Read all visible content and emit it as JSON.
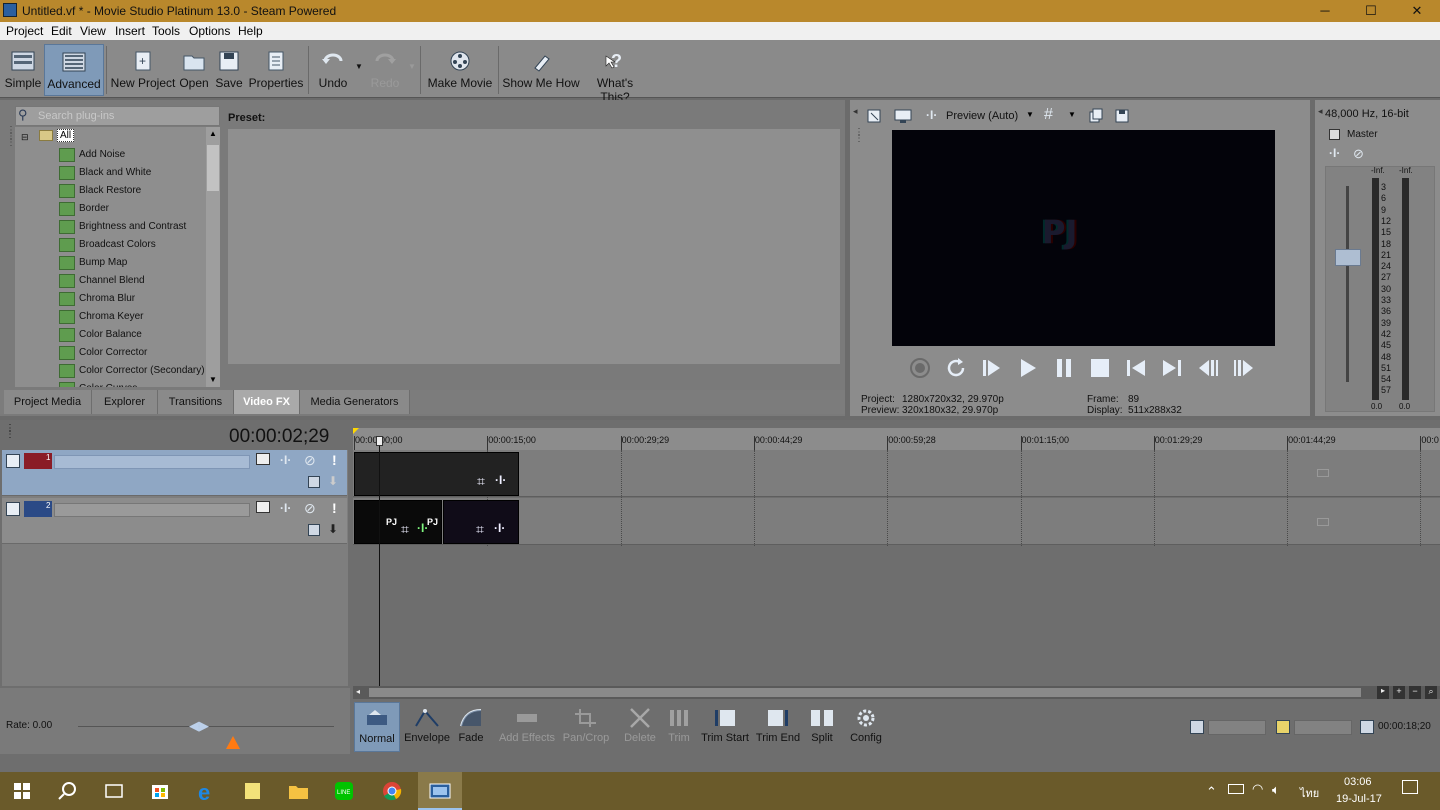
{
  "window": {
    "title": "Untitled.vf * - Movie Studio Platinum 13.0 - Steam Powered",
    "minimize": "─",
    "maximize": "☐",
    "close": "✕"
  },
  "menu": [
    "Project",
    "Edit",
    "View",
    "Insert",
    "Tools",
    "Options",
    "Help"
  ],
  "toolbar": {
    "simple": "Simple",
    "advanced": "Advanced",
    "new_project": "New Project",
    "open": "Open",
    "save": "Save",
    "properties": "Properties",
    "undo": "Undo",
    "redo": "Redo",
    "make_movie": "Make Movie",
    "show_me_how": "Show Me How",
    "whats_this": "What's This?"
  },
  "fx": {
    "search_placeholder": "Search plug-ins",
    "root": "All",
    "items": [
      "Add Noise",
      "Black and White",
      "Black Restore",
      "Border",
      "Brightness and Contrast",
      "Broadcast Colors",
      "Bump Map",
      "Channel Blend",
      "Chroma Blur",
      "Chroma Keyer",
      "Color Balance",
      "Color Corrector",
      "Color Corrector (Secondary)",
      "Color Curves"
    ],
    "preset_label": "Preset:"
  },
  "tabs": [
    "Project Media",
    "Explorer",
    "Transitions",
    "Video FX",
    "Media Generators"
  ],
  "tabs_selected": "Video FX",
  "preview": {
    "mode": "Preview (Auto)",
    "logo": "PJ",
    "project_label": "Project:",
    "project_value": "1280x720x32, 29.970p",
    "preview_label": "Preview:",
    "preview_value": "320x180x32, 29.970p",
    "frame_label": "Frame:",
    "frame_value": "89",
    "display_label": "Display:",
    "display_value": "511x288x32"
  },
  "mixer": {
    "format": "48,000 Hz, 16-bit",
    "master": "Master",
    "inf_l": "-Inf.",
    "inf_r": "-Inf.",
    "scale": [
      "3",
      "6",
      "9",
      "12",
      "15",
      "18",
      "21",
      "24",
      "27",
      "30",
      "33",
      "36",
      "39",
      "42",
      "45",
      "48",
      "51",
      "54",
      "57"
    ],
    "bottom_l": "0.0",
    "bottom_r": "0.0"
  },
  "timeline": {
    "timecode": "00:00:02;29",
    "ruler": [
      "00:00:00;00",
      "00:00:15;00",
      "00:00:29;29",
      "00:00:44;29",
      "00:00:59;28",
      "00:01:15;00",
      "00:01:29;29",
      "00:01:44;29",
      "00:0"
    ],
    "track1": "1",
    "track2": "2",
    "clip_logo": "PJ",
    "rate": "Rate: 0.00"
  },
  "bottom_tools": {
    "normal": "Normal",
    "envelope": "Envelope",
    "fade": "Fade",
    "add_effects": "Add Effects",
    "pan_crop": "Pan/Crop",
    "delete": "Delete",
    "trim": "Trim",
    "trim_start": "Trim Start",
    "trim_end": "Trim End",
    "split": "Split",
    "config": "Config",
    "end_time": "00:00:18;20"
  },
  "taskbar": {
    "time": "03:06",
    "date": "19-Jul-17",
    "lang": "ไทย"
  }
}
